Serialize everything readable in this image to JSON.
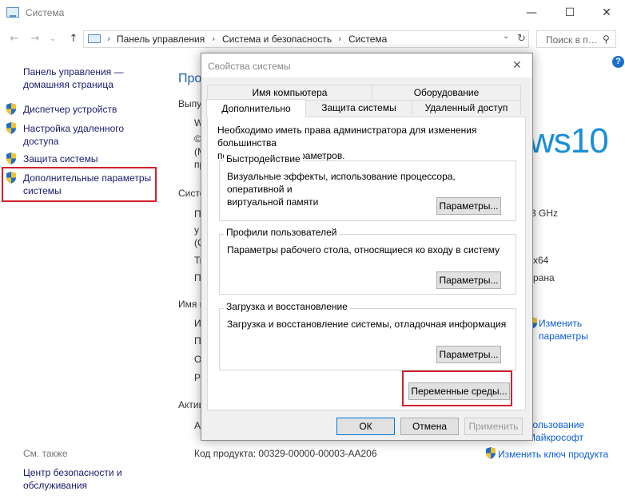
{
  "window": {
    "title": "Система",
    "minimize": "—",
    "maximize": "☐",
    "close": "✕"
  },
  "nav": {
    "back": "←",
    "forward": "→",
    "dropdown": "⌄",
    "up": "↑",
    "refresh": "↻",
    "addr_dropdown": "⌄"
  },
  "breadcrumb": {
    "items": [
      "Панель управления",
      "Система и безопасность",
      "Система"
    ],
    "sep": "›"
  },
  "search": {
    "placeholder": "Поиск в п…",
    "icon": "⚲"
  },
  "help": "?",
  "sidebar": {
    "home_line1": "Панель управления —",
    "home_line2": "домашняя страница",
    "items": [
      {
        "label1": "Диспетчер устройств",
        "label2": ""
      },
      {
        "label1": "Настройка удаленного",
        "label2": "доступа"
      },
      {
        "label1": "Защита системы",
        "label2": ""
      },
      {
        "label1": "Дополнительные параметры",
        "label2": "системы"
      }
    ],
    "see_also": "См. также",
    "security_line1": "Центр безопасности и",
    "security_line2": "обслуживания"
  },
  "background": {
    "heading": "Про",
    "section1": "Выпу",
    "w": "W",
    "c1": "©",
    "m": "(М",
    "r1": "пр",
    "section2": "Систе",
    "p1": "П",
    "y": "у",
    "c2": "(С",
    "t": "Ти",
    "p2": "П",
    "section3": "Имя к",
    "i": "И",
    "p3": "П",
    "o": "О",
    "r2": "Ра",
    "section4": "Актив",
    "a": "А",
    "win10": "ws10",
    "ghz": "3 GHz",
    "x64": "x64",
    "rana": "рана",
    "change1": "Изменить",
    "change2": "параметры",
    "usage": "пользование",
    "microsoft": "Майкрософт",
    "product_code": "Код продукта:  00329-00000-00003-AA206",
    "change_key": "Изменить ключ продукта"
  },
  "dialog": {
    "title": "Свойства системы",
    "close": "✕",
    "tabs_back": [
      "Имя компьютера",
      "Оборудование"
    ],
    "tabs_front": [
      "Дополнительно",
      "Защита системы",
      "Удаленный доступ"
    ],
    "admin_note_line1": "Необходимо иметь права администратора для изменения большинства",
    "admin_note_line2": "перечисленных параметров.",
    "perf": {
      "title": "Быстродействие",
      "desc_line1": "Визуальные эффекты, использование процессора, оперативной и",
      "desc_line2": "виртуальной памяти",
      "button": "Параметры..."
    },
    "profiles": {
      "title": "Профили пользователей",
      "desc": "Параметры рабочего стола, относящиеся ко входу в систему",
      "button": "Параметры..."
    },
    "startup": {
      "title": "Загрузка и восстановление",
      "desc": "Загрузка и восстановление системы, отладочная информация",
      "button": "Параметры..."
    },
    "env_button": "Переменные среды...",
    "ok": "ОК",
    "cancel": "Отмена",
    "apply": "Применить"
  },
  "colors": {
    "highlight_red": "#d0202a",
    "link_blue": "#0b5ed7",
    "win10_blue": "#1a8fd8"
  }
}
